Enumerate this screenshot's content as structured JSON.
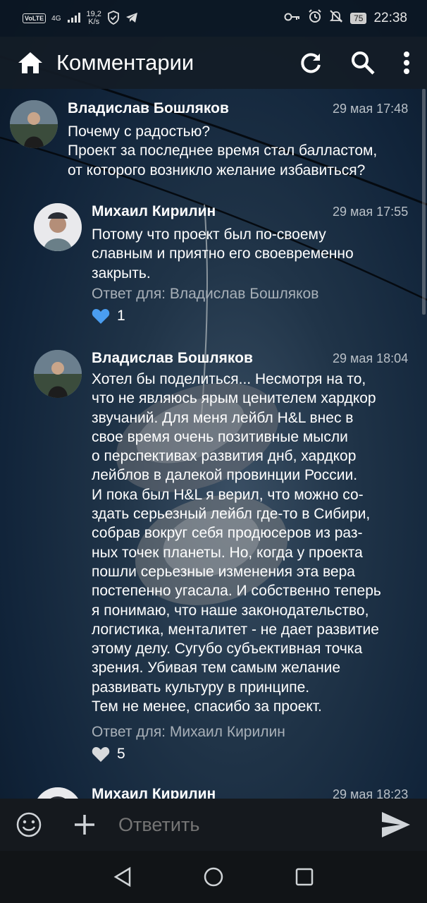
{
  "status_bar": {
    "volte": "VoLTE",
    "network": "4G",
    "speed_value": "19,2",
    "speed_unit": "K/s",
    "battery": "75",
    "time": "22:38"
  },
  "app_bar": {
    "title": "Комментарии",
    "icons": [
      "home-icon",
      "refresh-icon",
      "search-icon",
      "more-icon"
    ]
  },
  "comments": [
    {
      "author": "Владислав Бошляков",
      "date": "29 мая 17:48",
      "text": "Почему с радостью?\nПроект за последнее время стал балластом,\nот которого возникло желание избавиться?",
      "reply_to": "",
      "likes": ""
    },
    {
      "author": "Михаил Кирилин",
      "date": "29 мая 17:55",
      "text": "Потому что проект был по-своему\nславным и приятно его своевременно\nзакрыть.",
      "reply_to": "Ответ для: Владислав Бошляков",
      "likes": "1",
      "liked": true
    },
    {
      "author": "Владислав Бошляков",
      "date": "29 мая 18:04",
      "text": "Хотел бы поделиться... Несмотря на то,\nчто не являюсь ярым ценителем хардкор\nзвучаний. Для меня лейбл H&L внес в\nсвое время очень позитивные мысли\nо перспективах развития днб, хардкор\nлейблов в далекой провинции России.\nИ пока был H&L я верил, что можно со-\nздать серьезный лейбл где-то в Сибири,\nсобрав вокруг себя продюсеров из раз-\nных точек планеты. Но, когда у проекта\nпошли серьезные изменения эта вера\nпостепенно угасала. И собственно теперь\nя понимаю, что наше законодательство,\nлогистика, менталитет - не дает развитие\nэтому делу. Сугубо субъективная точка\nзрения. Убивая тем самым желание\nразвивать культуру в принципе.\nТем не менее, спасибо за проект.",
      "reply_to": "Ответ для: Михаил Кирилин",
      "likes": "5",
      "liked": false
    },
    {
      "author": "Михаил Кирилин",
      "date": "29 мая 18:23",
      "text": "",
      "reply_to": "",
      "likes": ""
    }
  ],
  "reply_bar": {
    "placeholder": "Ответить",
    "icons": [
      "emoji-icon",
      "plus-icon",
      "send-icon"
    ]
  },
  "nav_bar": {
    "icons": [
      "back-icon",
      "home-circle-icon",
      "recents-icon"
    ]
  },
  "colors": {
    "accent_like": "#4a9df0",
    "meta_text": "#a8b0b8"
  }
}
